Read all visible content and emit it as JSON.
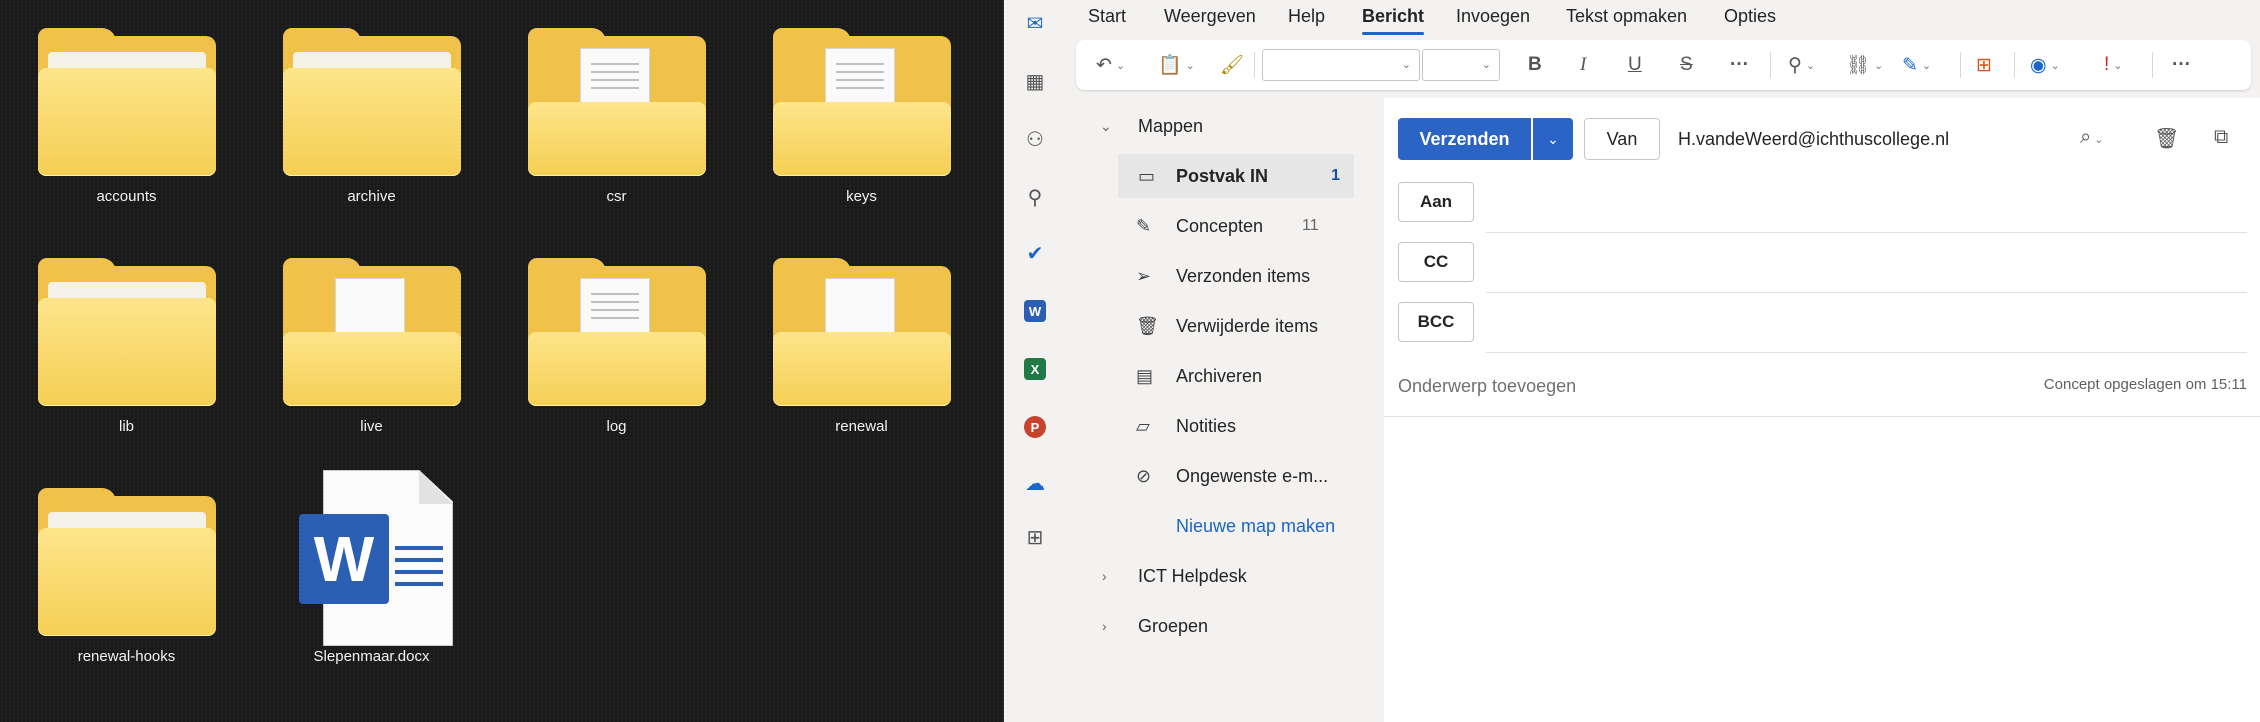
{
  "explorer": {
    "items": [
      {
        "name": "accounts",
        "kind": "folder"
      },
      {
        "name": "archive",
        "kind": "folder"
      },
      {
        "name": "csr",
        "kind": "folder-docs"
      },
      {
        "name": "keys",
        "kind": "folder-docs"
      },
      {
        "name": "lib",
        "kind": "folder"
      },
      {
        "name": "live",
        "kind": "folder-docs"
      },
      {
        "name": "log",
        "kind": "folder-docs"
      },
      {
        "name": "renewal",
        "kind": "folder-docs"
      },
      {
        "name": "renewal-hooks",
        "kind": "folder"
      },
      {
        "name": "Slepenmaar.docx",
        "kind": "word-document",
        "badge": "W"
      }
    ]
  },
  "outlook": {
    "menu": [
      "Start",
      "Weergeven",
      "Help",
      "Bericht",
      "Invoegen",
      "Tekst opmaken",
      "Opties"
    ],
    "active_menu": "Bericht",
    "folders": {
      "header": "Mappen",
      "items": [
        {
          "label": "Postvak IN",
          "count": "1",
          "icon": "inbox-icon"
        },
        {
          "label": "Concepten",
          "count": "11",
          "icon": "drafts-icon"
        },
        {
          "label": "Verzonden items",
          "count": "",
          "icon": "sent-icon"
        },
        {
          "label": "Verwijderde items",
          "count": "",
          "icon": "trash-icon"
        },
        {
          "label": "Archiveren",
          "count": "",
          "icon": "archive-icon"
        },
        {
          "label": "Notities",
          "count": "",
          "icon": "notes-icon"
        },
        {
          "label": "Ongewenste e-m...",
          "count": "",
          "icon": "junk-icon"
        }
      ],
      "new_folder": "Nieuwe map maken",
      "groups": [
        "ICT Helpdesk",
        "Groepen"
      ]
    },
    "compose": {
      "send": "Verzenden",
      "from_button": "Van",
      "from_address": "H.vandeWeerd@ichthuscollege.nl",
      "to": "Aan",
      "cc": "CC",
      "bcc": "BCC",
      "subject_placeholder": "Onderwerp toevoegen",
      "saved_note": "Concept opgeslagen om 15:11"
    },
    "colors": {
      "accent": "#2b64c5",
      "folder": "#f5cf54"
    }
  }
}
